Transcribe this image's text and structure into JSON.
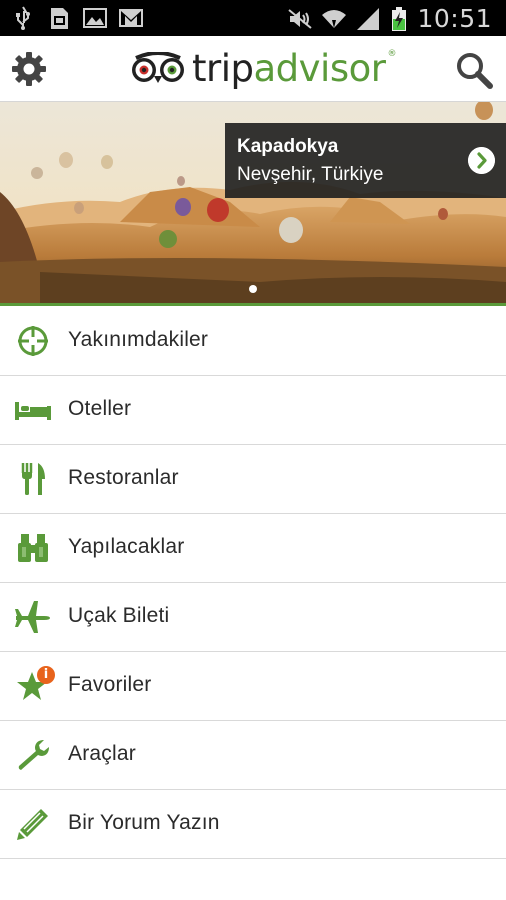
{
  "status_bar": {
    "time": "10:51",
    "icons": [
      "usb-icon",
      "sim-icon",
      "image-icon",
      "gmail-icon",
      "mute-icon",
      "wifi-icon",
      "signal-icon",
      "battery-charging-icon"
    ]
  },
  "header": {
    "logo_trip": "trip",
    "logo_advisor": "advisor",
    "logo_reg": "®",
    "settings_icon": "gear-icon",
    "search_icon": "search-icon",
    "brand_color": "#5a9a3a"
  },
  "hero": {
    "title": "Kapadokya",
    "subtitle": "Nevşehir, Türkiye",
    "pager_count": 1,
    "pager_active": 0
  },
  "menu": {
    "items": [
      {
        "label": "Yakınımdakiler",
        "icon": "crosshair-icon"
      },
      {
        "label": "Oteller",
        "icon": "bed-icon"
      },
      {
        "label": "Restoranlar",
        "icon": "fork-knife-icon"
      },
      {
        "label": "Yapılacaklar",
        "icon": "binoculars-icon"
      },
      {
        "label": "Uçak Bileti",
        "icon": "airplane-icon"
      },
      {
        "label": "Favoriler",
        "icon": "star-icon",
        "badge": "i"
      },
      {
        "label": "Araçlar",
        "icon": "wrench-icon"
      },
      {
        "label": "Bir Yorum Yazın",
        "icon": "pencil-icon"
      }
    ]
  }
}
